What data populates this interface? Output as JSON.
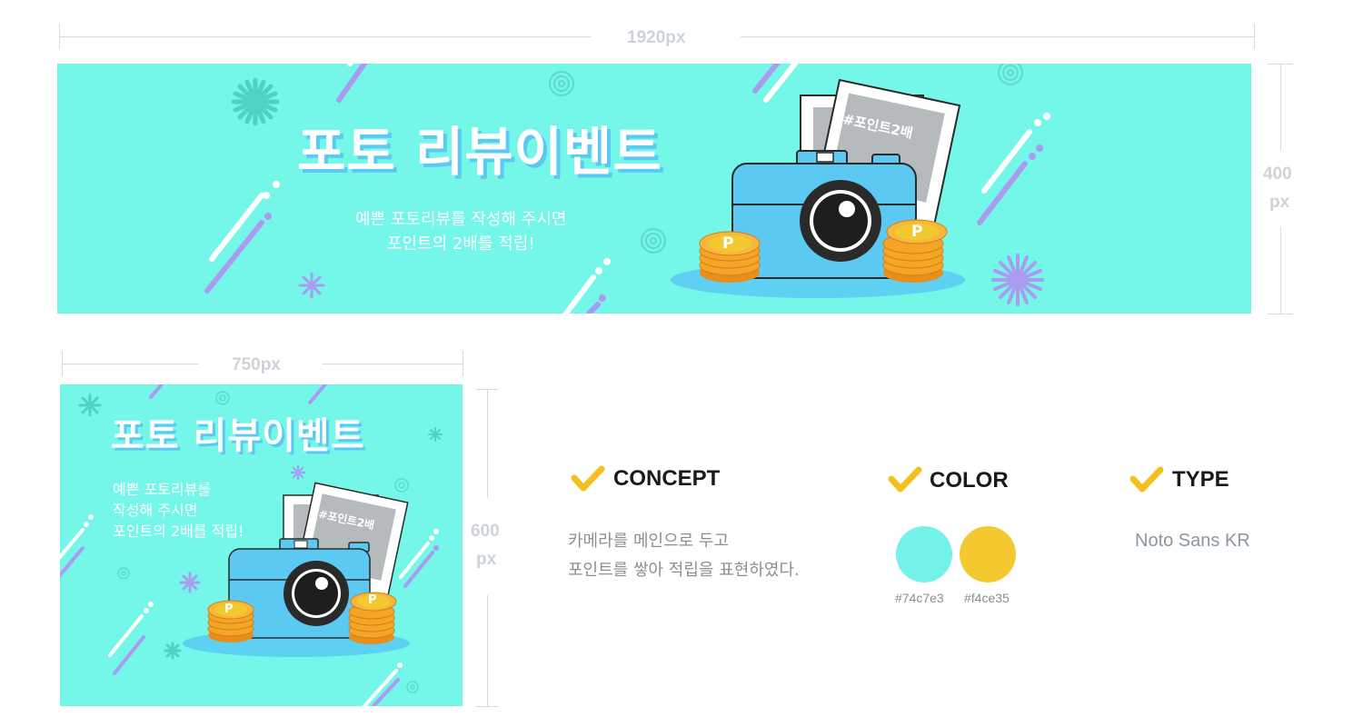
{
  "wide_banner": {
    "width_label": "1920px",
    "height_label_1": "400",
    "height_label_2": "px",
    "title": "포토 리뷰이벤트",
    "subtitle_line1": "예쁜 포토리뷰를 작성해 주시면",
    "subtitle_line2": "포인트의 2배를 적립!",
    "photo_tag": "#포인트2배",
    "coin_letter": "P"
  },
  "square_banner": {
    "width_label": "750px",
    "height_label_1": "600",
    "height_label_2": "px",
    "title": "포토 리뷰이벤트",
    "subtitle_line1": "예쁜 포토리뷰를",
    "subtitle_line2": "작성해 주시면",
    "subtitle_line3": "포인트의 2배를 적립!",
    "photo_tag": "#포인트2배",
    "coin_letter": "P"
  },
  "concept": {
    "title": "CONCEPT",
    "line1": "카메라를 메인으로 두고",
    "line2": "포인트를 쌓아 적립을 표현하였다."
  },
  "color": {
    "title": "COLOR",
    "swatches": [
      {
        "hex": "#74c7e3",
        "fill": "#74f2ea"
      },
      {
        "hex": "#f4ce35",
        "fill": "#f4c92f"
      }
    ]
  },
  "type": {
    "title": "TYPE",
    "font_name": "Noto Sans KR"
  },
  "colors": {
    "banner_bg": "#74f7e9",
    "camera_body": "#5bc9f2",
    "coin": "#f4a526",
    "check": "#f4c020",
    "accent_purple": "#a99cf0"
  }
}
